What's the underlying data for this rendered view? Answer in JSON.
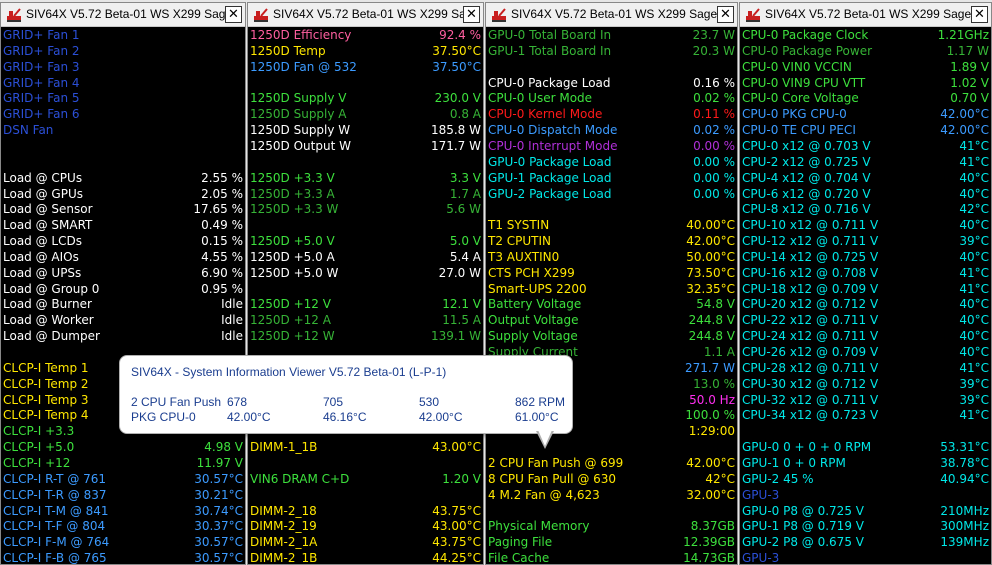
{
  "colors": {
    "white": "#ffffff",
    "navy": "#2b4fd6",
    "blue": "#3c9bff",
    "green": "#3de03d",
    "dkgreen": "#36b336",
    "yellow": "#ffe700",
    "cyan": "#00e8e8",
    "pink": "#ff5fa0",
    "red": "#ff1a1a",
    "purple": "#b030d8",
    "magenta": "#ff2ff0"
  },
  "windows": [
    {
      "title": "SIV64X V5.72 Beta-01  WS X299 Sage",
      "close": "✕",
      "rows": [
        {
          "label": "GRID+ Fan 1",
          "value": "",
          "color": "navy",
          "row": 0
        },
        {
          "label": "GRID+ Fan 2",
          "value": "",
          "color": "navy",
          "row": 1
        },
        {
          "label": "GRID+ Fan 3",
          "value": "",
          "color": "navy",
          "row": 2
        },
        {
          "label": "GRID+ Fan 4",
          "value": "",
          "color": "navy",
          "row": 3
        },
        {
          "label": "GRID+ Fan 5",
          "value": "",
          "color": "navy",
          "row": 4
        },
        {
          "label": "GRID+ Fan 6",
          "value": "",
          "color": "navy",
          "row": 5
        },
        {
          "label": "DSN Fan",
          "value": "",
          "color": "navy",
          "row": 6
        },
        {
          "label": "Load @ CPUs",
          "value": "2.55 %",
          "color": "white",
          "row": 9
        },
        {
          "label": "Load @ GPUs",
          "value": "2.05 %",
          "color": "white",
          "row": 10
        },
        {
          "label": "Load @ Sensor",
          "value": "17.65 %",
          "color": "white",
          "row": 11
        },
        {
          "label": "Load @ SMART",
          "value": "0.49 %",
          "color": "white",
          "row": 12
        },
        {
          "label": "Load @ LCDs",
          "value": "0.15 %",
          "color": "white",
          "row": 13
        },
        {
          "label": "Load @ AIOs",
          "value": "4.55 %",
          "color": "white",
          "row": 14
        },
        {
          "label": "Load @ UPSs",
          "value": "6.90 %",
          "color": "white",
          "row": 15
        },
        {
          "label": "Load @ Group 0",
          "value": "0.95 %",
          "color": "white",
          "row": 16
        },
        {
          "label": "Load @ Burner",
          "value": "Idle",
          "color": "white",
          "row": 17
        },
        {
          "label": "Load @ Worker",
          "value": "Idle",
          "color": "white",
          "row": 18
        },
        {
          "label": "Load @ Dumper",
          "value": "Idle",
          "color": "white",
          "row": 19
        },
        {
          "label": "CLCP-I Temp 1",
          "value": "",
          "color": "yellow",
          "row": 21
        },
        {
          "label": "CLCP-I Temp 2",
          "value": "",
          "color": "yellow",
          "row": 22
        },
        {
          "label": "CLCP-I Temp 3",
          "value": "",
          "color": "yellow",
          "row": 23
        },
        {
          "label": "CLCP-I Temp 4",
          "value": "",
          "color": "yellow",
          "row": 24
        },
        {
          "label": "CLCP-I +3.3",
          "value": "",
          "color": "green",
          "row": 25
        },
        {
          "label": "CLCP-I +5.0",
          "value": "4.98 V",
          "color": "green",
          "row": 26
        },
        {
          "label": "CLCP-I +12",
          "value": "11.97 V",
          "color": "green",
          "row": 27
        },
        {
          "label": "CLCP-I R-T @ 761",
          "value": "30.57°C",
          "color": "blue",
          "row": 28
        },
        {
          "label": "CLCP-I T-R @ 837",
          "value": "30.21°C",
          "color": "blue",
          "row": 29
        },
        {
          "label": "CLCP-I T-M @ 841",
          "value": "30.74°C",
          "color": "blue",
          "row": 30
        },
        {
          "label": "CLCP-I T-F @ 804",
          "value": "30.37°C",
          "color": "blue",
          "row": 31
        },
        {
          "label": "CLCP-I F-M @ 764",
          "value": "30.57°C",
          "color": "blue",
          "row": 32
        },
        {
          "label": "CLCP-I F-B @ 765",
          "value": "30.57°C",
          "color": "blue",
          "row": 33
        }
      ]
    },
    {
      "title": "SIV64X V5.72 Beta-01  WS X299 Sa...",
      "close": "✕",
      "rows": [
        {
          "label": "1250D Efficiency",
          "value": "92.4 %",
          "color": "pink",
          "row": 0
        },
        {
          "label": "1250D Temp",
          "value": "37.50°C",
          "color": "yellow",
          "row": 1
        },
        {
          "label": "1250D Fan @ 532",
          "value": "37.50°C",
          "color": "blue",
          "row": 2
        },
        {
          "label": "1250D Supply V",
          "value": "230.0 V",
          "color": "green",
          "row": 4
        },
        {
          "label": "1250D Supply A",
          "value": "0.8 A",
          "color": "dkgreen",
          "row": 5
        },
        {
          "label": "1250D Supply W",
          "value": "185.8 W",
          "color": "white",
          "row": 6
        },
        {
          "label": "1250D Output W",
          "value": "171.7 W",
          "color": "white",
          "row": 7
        },
        {
          "label": "1250D +3.3 V",
          "value": "3.3 V",
          "color": "green",
          "row": 9
        },
        {
          "label": "1250D +3.3 A",
          "value": "1.7 A",
          "color": "dkgreen",
          "row": 10
        },
        {
          "label": "1250D +3.3 W",
          "value": "5.6 W",
          "color": "dkgreen",
          "row": 11
        },
        {
          "label": "1250D +5.0 V",
          "value": "5.0 V",
          "color": "green",
          "row": 13
        },
        {
          "label": "1250D +5.0 A",
          "value": "5.4 A",
          "color": "white",
          "row": 14
        },
        {
          "label": "1250D +5.0 W",
          "value": "27.0 W",
          "color": "white",
          "row": 15
        },
        {
          "label": "1250D +12 V",
          "value": "12.1 V",
          "color": "green",
          "row": 17
        },
        {
          "label": "1250D +12 A",
          "value": "11.5 A",
          "color": "dkgreen",
          "row": 18
        },
        {
          "label": "1250D +12 W",
          "value": "139.1 W",
          "color": "dkgreen",
          "row": 19
        },
        {
          "label": "DIMM-1_1B",
          "value": "43.00°C",
          "color": "yellow",
          "row": 26
        },
        {
          "label": "VIN6 DRAM C+D",
          "value": "1.20 V",
          "color": "green",
          "row": 28
        },
        {
          "label": "DIMM-2_18",
          "value": "43.75°C",
          "color": "yellow",
          "row": 30
        },
        {
          "label": "DIMM-2_19",
          "value": "43.00°C",
          "color": "yellow",
          "row": 31
        },
        {
          "label": "DIMM-2_1A",
          "value": "43.75°C",
          "color": "yellow",
          "row": 32
        },
        {
          "label": "DIMM-2_1B",
          "value": "44.25°C",
          "color": "yellow",
          "row": 33
        }
      ]
    },
    {
      "title": "SIV64X V5.72 Beta-01  WS X299 Sage",
      "close": "✕",
      "rows": [
        {
          "label": "GPU-0 Total Board In",
          "value": "23.7 W",
          "color": "dkgreen",
          "row": 0
        },
        {
          "label": "GPU-1 Total Board In",
          "value": "20.3 W",
          "color": "dkgreen",
          "row": 1
        },
        {
          "label": "CPU-0   Package Load",
          "value": "0.16 %",
          "color": "white",
          "row": 3
        },
        {
          "label": "CPU-0   User Mode",
          "value": "0.02 %",
          "color": "green",
          "row": 4
        },
        {
          "label": "CPU-0   Kernel Mode",
          "value": "0.11 %",
          "color": "red",
          "row": 5
        },
        {
          "label": "CPU-0   Dispatch Mode",
          "value": "0.02 %",
          "color": "blue",
          "row": 6
        },
        {
          "label": "CPU-0   Interrupt Mode",
          "value": "0.00 %",
          "color": "purple",
          "row": 7
        },
        {
          "label": "GPU-0   Package Load",
          "value": "0.00 %",
          "color": "cyan",
          "row": 8
        },
        {
          "label": "GPU-1   Package Load",
          "value": "0.00 %",
          "color": "cyan",
          "row": 9
        },
        {
          "label": "GPU-2   Package Load",
          "value": "0.00 %",
          "color": "cyan",
          "row": 10
        },
        {
          "label": "T1 SYSTIN",
          "value": "40.00°C",
          "color": "yellow",
          "row": 12
        },
        {
          "label": "T2 CPUTIN",
          "value": "42.00°C",
          "color": "yellow",
          "row": 13
        },
        {
          "label": "T3 AUXTIN0",
          "value": "50.00°C",
          "color": "yellow",
          "row": 14
        },
        {
          "label": "CTS PCH X299",
          "value": "73.50°C",
          "color": "yellow",
          "row": 15
        },
        {
          "label": "Smart-UPS 2200",
          "value": "32.35°C",
          "color": "yellow",
          "row": 16
        },
        {
          "label": "Battery Voltage",
          "value": "54.8 V",
          "color": "green",
          "row": 17
        },
        {
          "label": "Output Voltage",
          "value": "244.8 V",
          "color": "green",
          "row": 18
        },
        {
          "label": "Supply Voltage",
          "value": "244.8 V",
          "color": "green",
          "row": 19
        },
        {
          "label": "Supply Current",
          "value": "1.1 A",
          "color": "dkgreen",
          "row": 20
        },
        {
          "label": "",
          "value": "271.7 W",
          "color": "blue",
          "row": 21
        },
        {
          "label": "",
          "value": "13.0 %",
          "color": "dkgreen",
          "row": 22
        },
        {
          "label": "",
          "value": "50.0 Hz",
          "color": "magenta",
          "row": 23
        },
        {
          "label": "",
          "value": "100.0 %",
          "color": "green",
          "row": 24
        },
        {
          "label": "",
          "value": "1:29:00",
          "color": "yellow",
          "row": 25
        },
        {
          "label": "2 CPU Fan Push @ 699",
          "value": "42.00°C",
          "color": "yellow",
          "row": 27
        },
        {
          "label": "8 CPU Fan Pull @ 630",
          "value": "42°C",
          "color": "yellow",
          "row": 28
        },
        {
          "label": "4 M.2 Fan @ 4,623",
          "value": "32.00°C",
          "color": "yellow",
          "row": 29
        },
        {
          "label": "Physical Memory",
          "value": "8.37GB",
          "color": "green",
          "row": 31
        },
        {
          "label": "Paging File",
          "value": "12.39GB",
          "color": "green",
          "row": 32
        },
        {
          "label": "File Cache",
          "value": "14.73GB",
          "color": "green",
          "row": 33
        }
      ]
    },
    {
      "title": "SIV64X V5.72 Beta-01  WS X299 Sage",
      "close": "✕",
      "rows": [
        {
          "label": "CPU-0   Package Clock",
          "value": "1.21GHz",
          "color": "green",
          "row": 0
        },
        {
          "label": "CPU-0   Package Power",
          "value": "1.17 W",
          "color": "dkgreen",
          "row": 1
        },
        {
          "label": "CPU-0   VIN0 VCCIN",
          "value": "1.89 V",
          "color": "green",
          "row": 2
        },
        {
          "label": "CPU-0   VIN9 CPU VTT",
          "value": "1.02 V",
          "color": "green",
          "row": 3
        },
        {
          "label": "CPU-0   Core Voltage",
          "value": "0.70 V",
          "color": "green",
          "row": 4
        },
        {
          "label": "CPU-0   PKG CPU-0",
          "value": "42.00°C",
          "color": "blue",
          "row": 5
        },
        {
          "label": "CPU-0   TE CPU PECI",
          "value": "42.00°C",
          "color": "blue",
          "row": 6
        },
        {
          "label": "CPU-0   x12 @ 0.703 V",
          "value": "41°C",
          "color": "cyan",
          "row": 7
        },
        {
          "label": "CPU-2   x12 @ 0.725 V",
          "value": "41°C",
          "color": "cyan",
          "row": 8
        },
        {
          "label": "CPU-4   x12 @ 0.704 V",
          "value": "40°C",
          "color": "cyan",
          "row": 9
        },
        {
          "label": "CPU-6   x12 @ 0.720 V",
          "value": "40°C",
          "color": "cyan",
          "row": 10
        },
        {
          "label": "CPU-8   x12 @ 0.716 V",
          "value": "42°C",
          "color": "cyan",
          "row": 11
        },
        {
          "label": "CPU-10  x12 @ 0.711 V",
          "value": "40°C",
          "color": "cyan",
          "row": 12
        },
        {
          "label": "CPU-12  x12 @ 0.711 V",
          "value": "39°C",
          "color": "cyan",
          "row": 13
        },
        {
          "label": "CPU-14  x12 @ 0.725 V",
          "value": "40°C",
          "color": "cyan",
          "row": 14
        },
        {
          "label": "CPU-16  x12 @ 0.708 V",
          "value": "41°C",
          "color": "cyan",
          "row": 15
        },
        {
          "label": "CPU-18  x12 @ 0.709 V",
          "value": "41°C",
          "color": "cyan",
          "row": 16
        },
        {
          "label": "CPU-20  x12 @ 0.712 V",
          "value": "40°C",
          "color": "cyan",
          "row": 17
        },
        {
          "label": "CPU-22  x12 @ 0.711 V",
          "value": "40°C",
          "color": "cyan",
          "row": 18
        },
        {
          "label": "CPU-24  x12 @ 0.711 V",
          "value": "40°C",
          "color": "cyan",
          "row": 19
        },
        {
          "label": "CPU-26  x12 @ 0.709 V",
          "value": "40°C",
          "color": "cyan",
          "row": 20
        },
        {
          "label": "CPU-28  x12 @ 0.711 V",
          "value": "41°C",
          "color": "cyan",
          "row": 21
        },
        {
          "label": "CPU-30  x12 @ 0.712 V",
          "value": "39°C",
          "color": "cyan",
          "row": 22
        },
        {
          "label": "CPU-32  x12 @ 0.711 V",
          "value": "39°C",
          "color": "cyan",
          "row": 23
        },
        {
          "label": "CPU-34  x12 @ 0.723 V",
          "value": "41°C",
          "color": "cyan",
          "row": 24
        },
        {
          "label": "GPU-0   0 + 0 + 0 RPM",
          "value": "53.31°C",
          "color": "cyan",
          "row": 26
        },
        {
          "label": "GPU-1   0 + 0 RPM",
          "value": "38.78°C",
          "color": "cyan",
          "row": 27
        },
        {
          "label": "GPU-2   45 %",
          "value": "40.94°C",
          "color": "cyan",
          "row": 28
        },
        {
          "label": "GPU-3",
          "value": "",
          "color": "navy",
          "row": 29
        },
        {
          "label": "GPU-0   P8 @ 0.725 V",
          "value": "210MHz",
          "color": "cyan",
          "row": 30
        },
        {
          "label": "GPU-1   P8 @ 0.719 V",
          "value": "300MHz",
          "color": "cyan",
          "row": 31
        },
        {
          "label": "GPU-2   P8 @ 0.675 V",
          "value": "139MHz",
          "color": "cyan",
          "row": 32
        },
        {
          "label": "GPU-3",
          "value": "",
          "color": "navy",
          "row": 33
        }
      ]
    }
  ],
  "tooltip": {
    "title": "SIV64X - System Information Viewer V5.72 Beta-01 (L-P-1)",
    "rows": [
      [
        "2 CPU Fan Push",
        "678",
        "705",
        "530",
        "862 RPM"
      ],
      [
        "PKG CPU-0",
        "42.00°C",
        "46.16°C",
        "42.00°C",
        "61.00°C"
      ]
    ]
  }
}
